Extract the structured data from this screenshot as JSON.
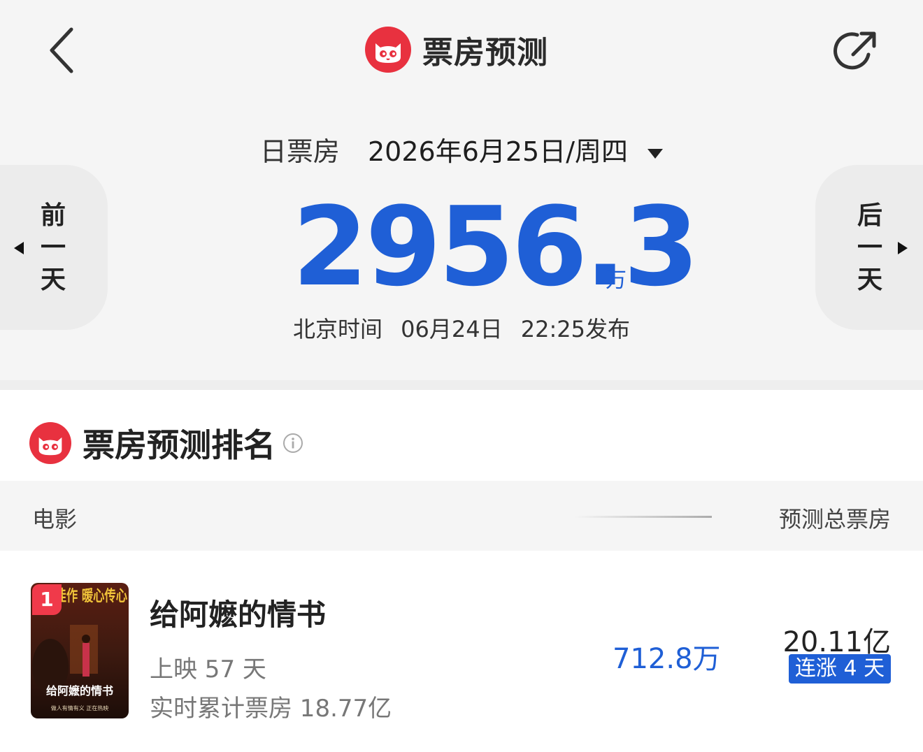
{
  "header": {
    "title": "票房预测",
    "back_icon": "chevron-left-icon",
    "share_icon": "share-icon",
    "logo_color": "#e8313f"
  },
  "summary": {
    "date_label": "日票房",
    "date_value": "2026年6月25日/周四",
    "prev_day": [
      "前",
      "一",
      "天"
    ],
    "next_day": [
      "后",
      "一",
      "天"
    ],
    "box_office_value": "2956.3",
    "box_office_unit": "万",
    "publish_tz": "北京时间",
    "publish_date": "06月24日",
    "publish_time": "22:25发布",
    "accent_color": "#1f5fd6"
  },
  "ranking": {
    "title": "票房预测排名",
    "col_movie": "电影",
    "col_total": "预测总票房",
    "movies": [
      {
        "rank": "1",
        "name": "给阿嬷的情书",
        "days_showing": "上映 57 天",
        "realtime_cumulative": "实时累计票房 18.77亿",
        "forecast_day": "712.8万",
        "forecast_total": "20.11亿",
        "streak": "连涨 4 天",
        "poster_top_text": "口碑佳作 暖心传心",
        "poster_title": "给阿嬷的情书",
        "poster_sub": "做人有情有义  正在热映"
      }
    ]
  }
}
